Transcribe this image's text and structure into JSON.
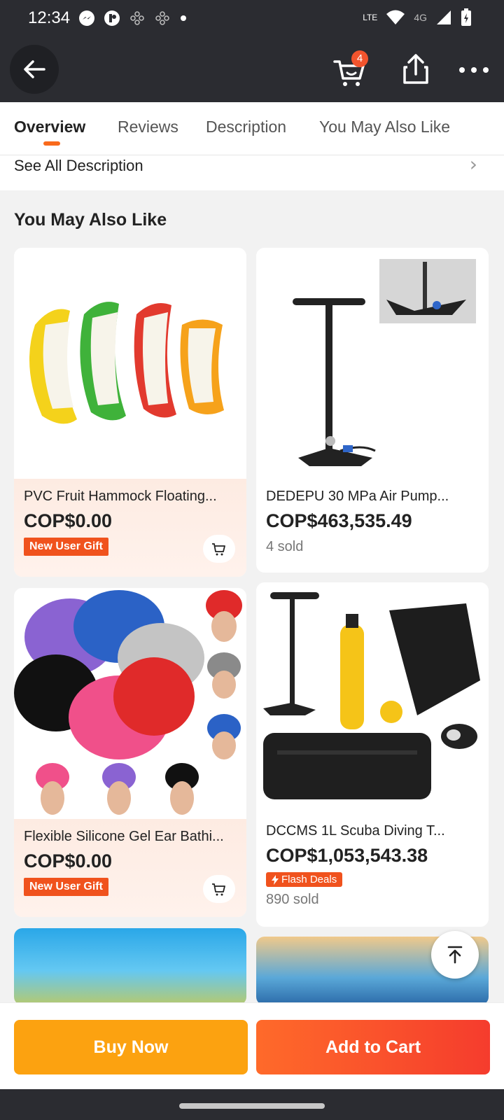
{
  "status_bar": {
    "time": "12:34",
    "network": "4G",
    "lte_label": "LTE"
  },
  "app_bar": {
    "cart_count": "4"
  },
  "tabs": [
    {
      "label": "Overview",
      "active": true
    },
    {
      "label": "Reviews",
      "active": false
    },
    {
      "label": "Description",
      "active": false
    },
    {
      "label": "You May Also Like",
      "active": false
    }
  ],
  "see_all": {
    "label": "See All Description"
  },
  "section": {
    "title": "You May Also Like"
  },
  "products": [
    {
      "title": "PVC Fruit Hammock Floating...",
      "price": "COP$0.00",
      "tag": "New User Gift"
    },
    {
      "title": "DEDEPU 30 MPa Air Pump...",
      "price": "COP$463,535.49",
      "sold": "4 sold"
    },
    {
      "title": "Flexible Silicone Gel Ear Bathi...",
      "price": "COP$0.00",
      "tag": "New User Gift"
    },
    {
      "title": "DCCMS 1L Scuba Diving T...",
      "price": "COP$1,053,543.38",
      "badge": "Flash Deals",
      "sold": "890 sold"
    }
  ],
  "bottom_bar": {
    "buy_now": "Buy Now",
    "add_to_cart": "Add to Cart"
  },
  "colors": {
    "accent": "#f96a1c",
    "gift_tag": "#f0521d",
    "buy_now": "#fca210",
    "add_to_cart": "#f53c2d",
    "dark_bar": "#2b2c31"
  },
  "icons": {
    "back": "arrow-left-icon",
    "cart": "cart-icon",
    "share": "share-icon",
    "more": "more-icon",
    "scroll_top": "arrow-up-icon"
  }
}
